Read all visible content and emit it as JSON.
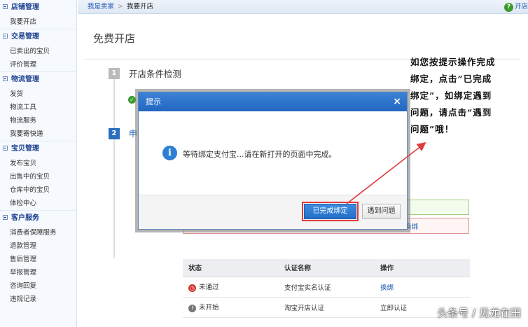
{
  "sidebar": {
    "groups": [
      {
        "title": "店铺管理",
        "items": [
          "我要开店"
        ]
      },
      {
        "title": "交易管理",
        "items": [
          "已卖出的宝贝",
          "评价管理"
        ]
      },
      {
        "title": "物流管理",
        "items": [
          "发货",
          "物流工具",
          "物流服务",
          "我要寄快递"
        ]
      },
      {
        "title": "宝贝管理",
        "items": [
          "发布宝贝",
          "出售中的宝贝",
          "仓库中的宝贝",
          "体检中心"
        ]
      },
      {
        "title": "客户服务",
        "items": [
          "消费者保障服务",
          "退款管理",
          "售后管理",
          "举报管理",
          "咨询回复",
          "违规记录"
        ]
      }
    ]
  },
  "topbar": {
    "crumb_link": "我是卖家",
    "crumb_sep": ">",
    "crumb_current": "我要开店",
    "help_label": "开店"
  },
  "page": {
    "title": "免费开店",
    "step1_num": "1",
    "step1_title": "开店条件检测",
    "step2_num": "2",
    "step2_title": "申",
    "red_link": "换绑"
  },
  "table": {
    "headers": [
      "状态",
      "认证名称",
      "操作"
    ],
    "rows": [
      {
        "status": "未通过",
        "name": "支付宝实名认证",
        "action": "换绑"
      },
      {
        "status": "未开始",
        "name": "淘宝开店认证",
        "action": "立即认证"
      }
    ]
  },
  "modal": {
    "title": "提示",
    "close": "×",
    "info_glyph": "i",
    "message": "等待绑定支付宝...请在新打开的页面中完成。",
    "primary_button": "已完成绑定",
    "secondary_button": "遇到问题"
  },
  "annotation": {
    "lines": [
      "如您按提示操作完成",
      "绑定，点击“已完成",
      "绑定”，如绑定遇到",
      "问题，请点击“遇到",
      "问题”哦！"
    ]
  },
  "watermark": "头条号 / 见龙在田",
  "colors": {
    "accent": "#2367c2",
    "highlight": "#e23b3b",
    "success": "#3a9b2c"
  }
}
